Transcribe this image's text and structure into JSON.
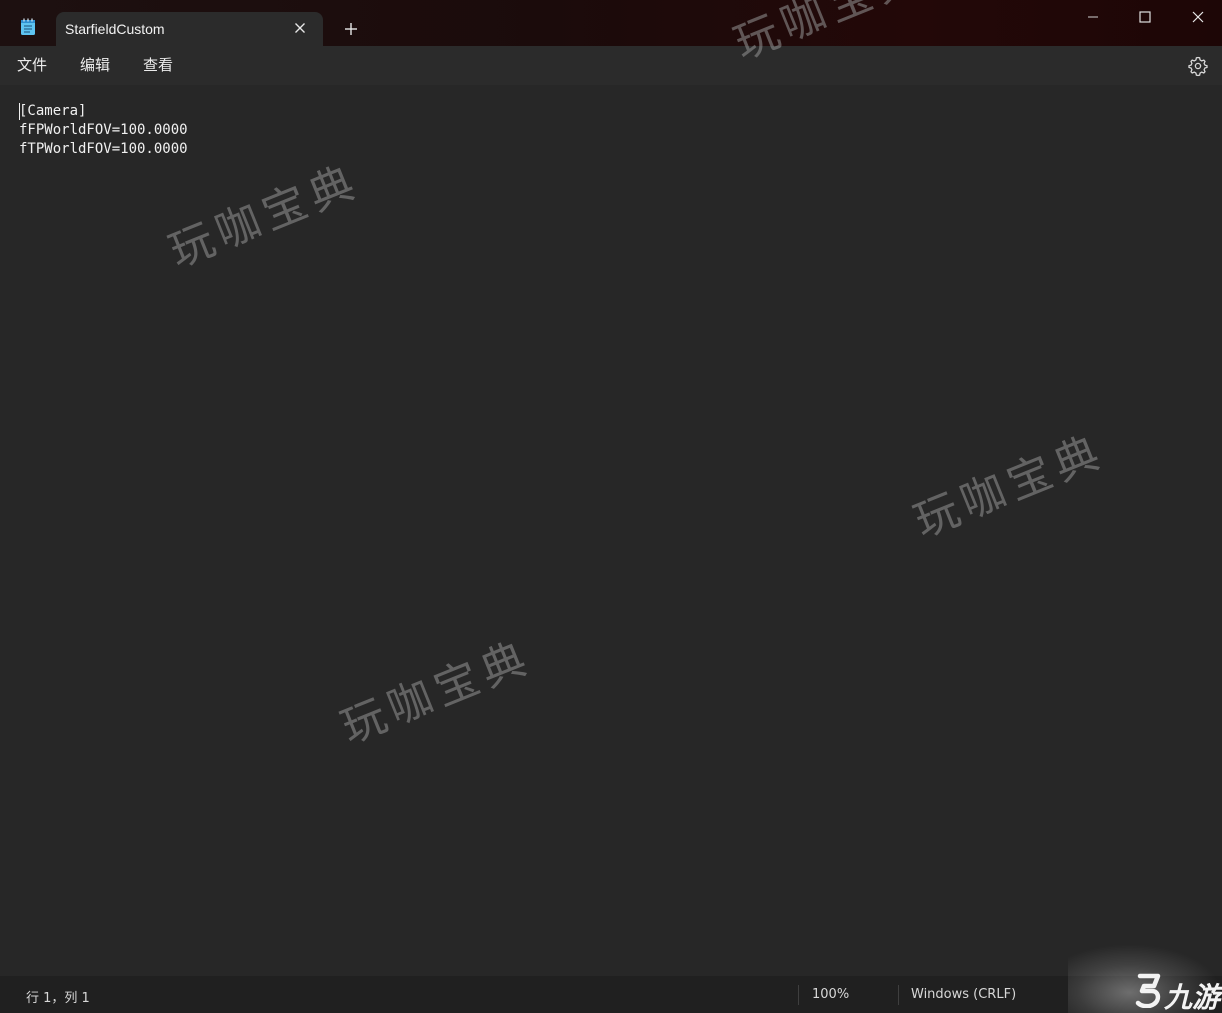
{
  "window": {
    "tab_title": "StarfieldCustom",
    "new_tab_label": "+",
    "accent_color": "#2b2b2b"
  },
  "icons": {
    "app": "notepad-icon",
    "tab_close": "close-icon",
    "new_tab": "plus-icon",
    "minimize": "minimize-icon",
    "maximize": "maximize-icon",
    "close": "close-icon",
    "settings": "gear-icon"
  },
  "menu": {
    "file": "文件",
    "edit": "编辑",
    "view": "查看"
  },
  "editor": {
    "lines": [
      "[Camera]",
      "fFPWorldFOV=100.0000",
      "fTPWorldFOV=100.0000"
    ]
  },
  "watermark": {
    "text": "玩咖宝典"
  },
  "status": {
    "position": "行 1，列 1",
    "zoom": "100%",
    "line_ending": "Windows (CRLF)"
  },
  "corner_logo": {
    "text": "九游"
  }
}
